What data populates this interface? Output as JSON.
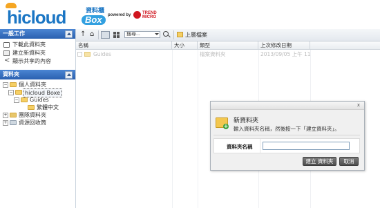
{
  "header": {
    "logo_text": "hicloud",
    "logo_box": "Box",
    "logo_zh": "資料櫃",
    "powered_by": "powered by",
    "trend_micro": "TREND MICRO"
  },
  "left_panel": {
    "tasks_title": "一般工作",
    "tasks": [
      {
        "icon": "upload-icon",
        "label": "下載此資料夾"
      },
      {
        "icon": "new-folder-icon",
        "label": "建立新資料夾"
      },
      {
        "icon": "share-icon",
        "label": "顯示共享的內容"
      }
    ],
    "folders_title": "資料夾",
    "tree": [
      {
        "label": "個人資料夾",
        "level": 0,
        "expanded": true
      },
      {
        "label": "hicloud Boxe",
        "level": 1,
        "expanded": true,
        "selected": true
      },
      {
        "label": "Guides",
        "level": 2,
        "expanded": true
      },
      {
        "label": "繁體中文",
        "level": 3,
        "expanded": false
      },
      {
        "label": "團隊資料夾",
        "level": 0,
        "expanded": false
      },
      {
        "label": "資源回收筒",
        "level": 0,
        "expanded": false
      }
    ]
  },
  "toolbar": {
    "search_value": "搜尋...",
    "up_level": "上層檔案"
  },
  "grid": {
    "columns": [
      "名稱",
      "大小",
      "類型",
      "上次修改日期"
    ],
    "rows": [
      {
        "name": "Guides",
        "size": "",
        "type": "檔案資料夾",
        "modified": "2013/09/05 上午 11:2"
      }
    ]
  },
  "dialog": {
    "heading": "新資料夾",
    "description": "輸入資料夾名稱，然後按一下「建立資料夾」。",
    "field_label": "資料夾名稱",
    "field_value": "",
    "create_button": "建立 資料夾",
    "cancel_button": "取消",
    "close_glyph": "x"
  }
}
